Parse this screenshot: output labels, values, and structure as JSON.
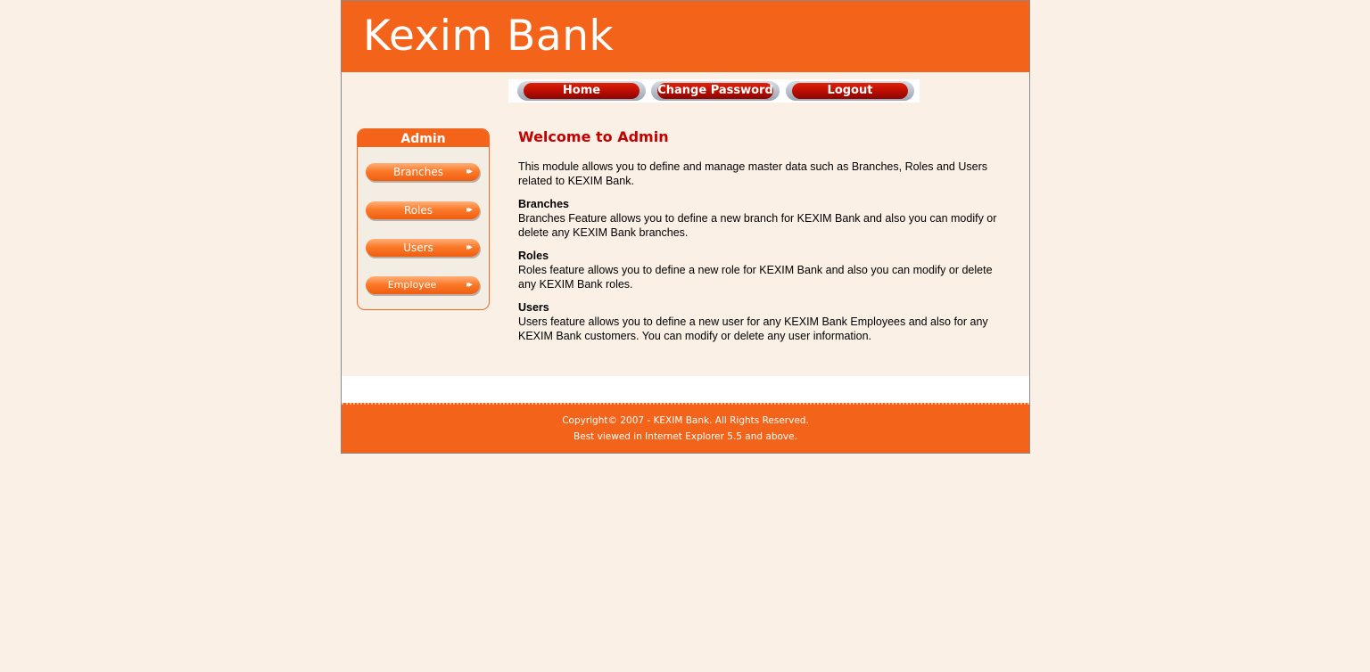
{
  "header": {
    "logo_text": "Kexim Bank"
  },
  "topnav": {
    "home": "Home",
    "change_password": "Change Password",
    "logout": "Logout"
  },
  "sidebar": {
    "title": "Admin",
    "items": [
      {
        "label": "Branches"
      },
      {
        "label": "Roles"
      },
      {
        "label": "Users"
      },
      {
        "label": "Employee"
      }
    ],
    "arrow_icon": "double-chevron-right"
  },
  "main": {
    "title": "Welcome to Admin",
    "intro": "This module allows you to define and manage master data such as Branches, Roles and Users related to KEXIM Bank.",
    "sections": [
      {
        "heading": "Branches",
        "text": "Branches Feature allows you to define a new branch for KEXIM Bank and also you can modify or delete any KEXIM Bank branches."
      },
      {
        "heading": "Roles",
        "text": "Roles feature allows you to define a new role for KEXIM Bank and also you can modify or delete any KEXIM Bank roles."
      },
      {
        "heading": "Users",
        "text": "Users feature allows you to define a new user for any KEXIM Bank Employees and also for any KEXIM Bank customers. You can modify or delete any user information."
      }
    ]
  },
  "footer": {
    "copyright": "Copyright© 2007 - KEXIM Bank. All Rights Reserved.",
    "browser_note": "Best viewed in Internet Explorer 5.5 and above."
  },
  "colors": {
    "brand_orange": "#f4631a",
    "title_red": "#c40000",
    "background": "#faf0e6"
  }
}
